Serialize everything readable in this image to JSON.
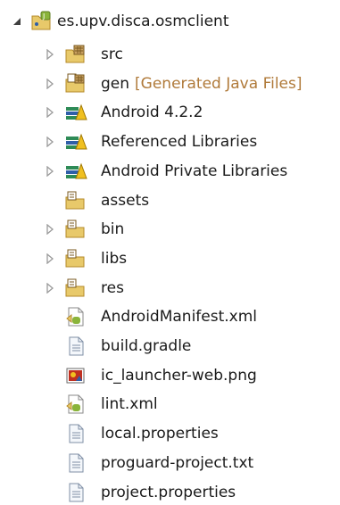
{
  "tree": {
    "project": {
      "label": "es.upv.disca.osmclient",
      "icon": "android-project-icon",
      "expanded": true
    },
    "items": [
      {
        "label": "src",
        "decoration": "",
        "icon": "source-package-folder-icon",
        "expandable": true
      },
      {
        "label": "gen",
        "decoration": "[Generated Java Files]",
        "icon": "generated-source-folder-icon",
        "expandable": true
      },
      {
        "label": "Android 4.2.2",
        "decoration": "",
        "icon": "library-container-icon",
        "expandable": true
      },
      {
        "label": "Referenced Libraries",
        "decoration": "",
        "icon": "library-container-icon",
        "expandable": true
      },
      {
        "label": "Android Private Libraries",
        "decoration": "",
        "icon": "library-container-icon",
        "expandable": true
      },
      {
        "label": "assets",
        "decoration": "",
        "icon": "folder-icon",
        "expandable": false
      },
      {
        "label": "bin",
        "decoration": "",
        "icon": "folder-icon",
        "expandable": true
      },
      {
        "label": "libs",
        "decoration": "",
        "icon": "folder-icon",
        "expandable": true
      },
      {
        "label": "res",
        "decoration": "",
        "icon": "folder-icon",
        "expandable": true
      },
      {
        "label": "AndroidManifest.xml",
        "decoration": "",
        "icon": "android-manifest-icon",
        "expandable": false
      },
      {
        "label": "build.gradle",
        "decoration": "",
        "icon": "text-file-icon",
        "expandable": false
      },
      {
        "label": "ic_launcher-web.png",
        "decoration": "",
        "icon": "image-file-icon",
        "expandable": false
      },
      {
        "label": "lint.xml",
        "decoration": "",
        "icon": "android-manifest-icon",
        "expandable": false
      },
      {
        "label": "local.properties",
        "decoration": "",
        "icon": "text-file-icon",
        "expandable": false
      },
      {
        "label": "proguard-project.txt",
        "decoration": "",
        "icon": "text-file-icon",
        "expandable": false
      },
      {
        "label": "project.properties",
        "decoration": "",
        "icon": "text-file-icon",
        "expandable": false
      }
    ]
  },
  "colors": {
    "text": "#1a1a1a",
    "decoration": "#b07a3a",
    "arrow": "#9a9a9a",
    "folder": "#e8c96a",
    "folder_stroke": "#b58a2a",
    "library_green": "#2e8b57",
    "library_blue": "#2f5fa8",
    "library_yellow": "#f0c020",
    "android_green": "#8ab43a"
  }
}
